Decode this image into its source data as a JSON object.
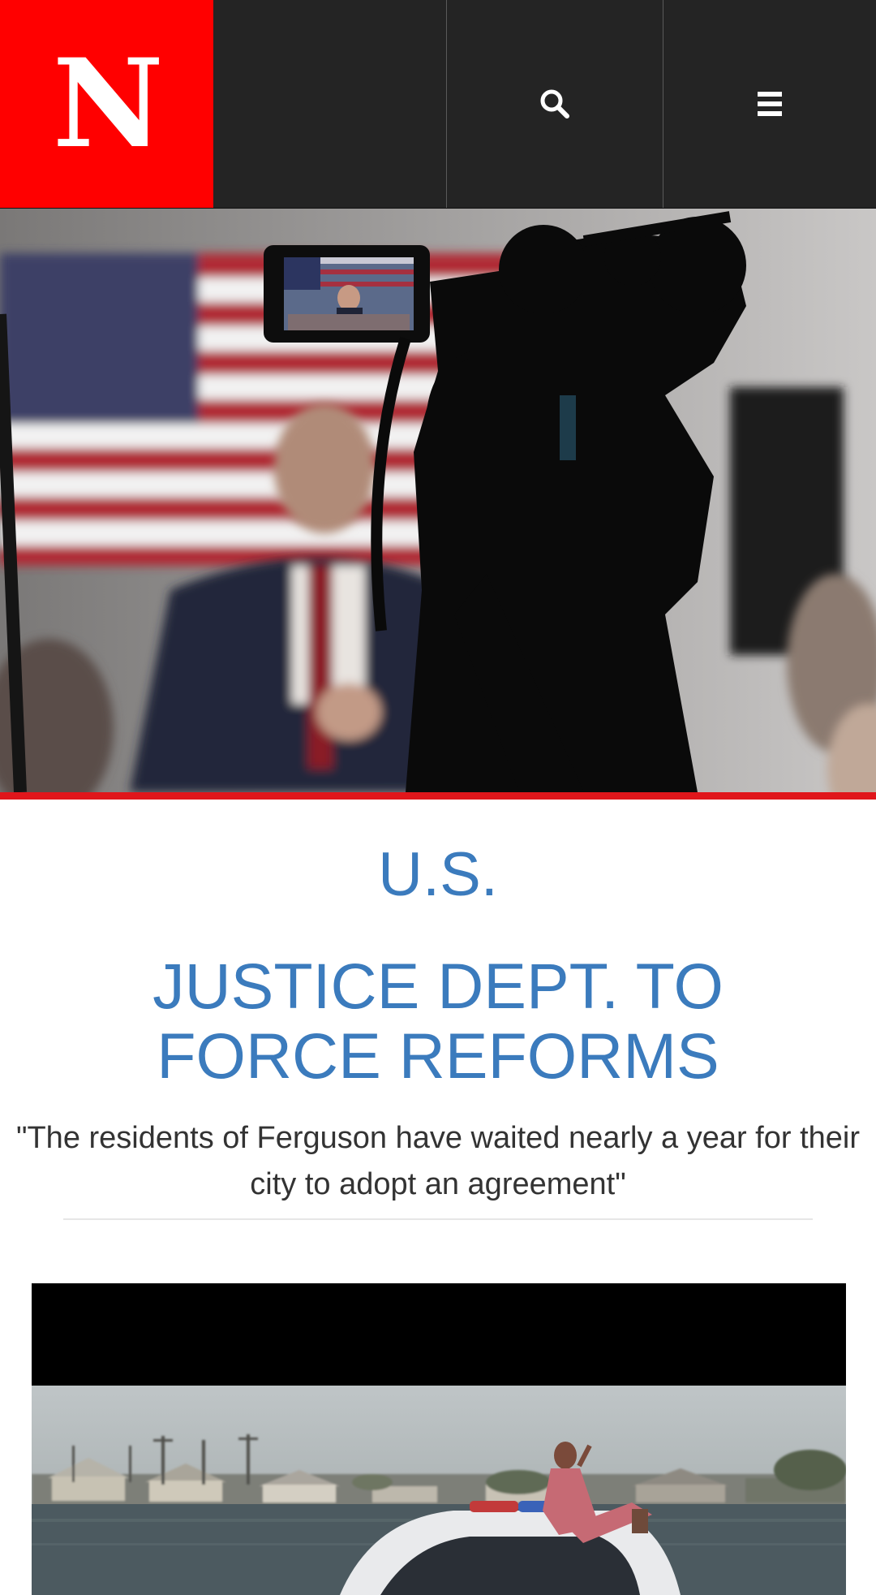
{
  "header": {
    "logo_letter": "N",
    "search_icon": "search-icon",
    "menu_icon": "hamburger-menu-icon",
    "brand_color": "#ff0000"
  },
  "hero": {
    "image_alt": "Camera filming candidate speaking in front of an American flag",
    "accent_color": "#e0161b"
  },
  "article": {
    "section": "U.S.",
    "headline": "JUSTICE DEPT. TO FORCE REFORMS",
    "dek": "\"The residents of Ferguson have waited nearly a year for their city to adopt an agreement\"",
    "link_color": "#3b7bbd"
  },
  "video": {
    "image_alt": "Woman sitting atop a police car in floodwater"
  }
}
